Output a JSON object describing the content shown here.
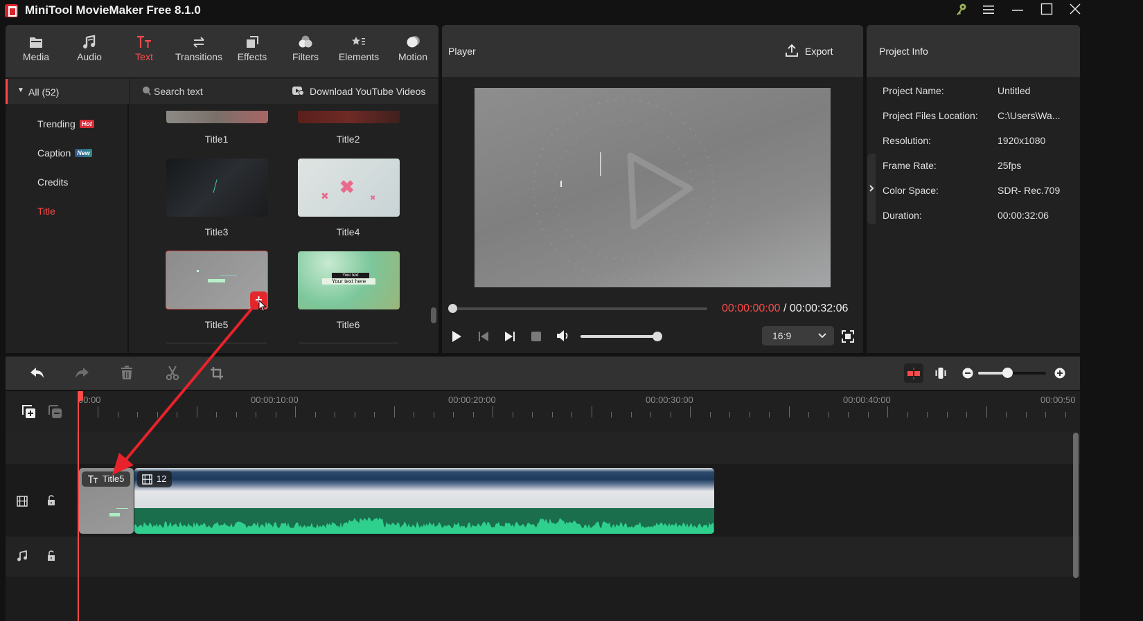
{
  "window": {
    "title": "MiniTool MovieMaker Free 8.1.0",
    "controls": [
      "key-icon",
      "menu-icon",
      "minimize-icon",
      "maximize-icon",
      "close-icon"
    ]
  },
  "top_tabs": [
    {
      "label": "Media",
      "icon": "folder-icon"
    },
    {
      "label": "Audio",
      "icon": "music-note-icon"
    },
    {
      "label": "Text",
      "icon": "text-icon",
      "active": true
    },
    {
      "label": "Transitions",
      "icon": "swap-arrows-icon"
    },
    {
      "label": "Effects",
      "icon": "layers-icon"
    },
    {
      "label": "Filters",
      "icon": "filters-icon"
    },
    {
      "label": "Elements",
      "icon": "star-list-icon"
    },
    {
      "label": "Motion",
      "icon": "motion-ball-icon"
    }
  ],
  "library": {
    "all_label": "All (52)",
    "categories": [
      {
        "label": "Trending",
        "badge": "Hot"
      },
      {
        "label": "Caption",
        "badge": "New"
      },
      {
        "label": "Credits",
        "badge": ""
      },
      {
        "label": "Title",
        "badge": "",
        "active": true
      }
    ],
    "search_placeholder": "Search text",
    "download_label": "Download YouTube Videos",
    "items": [
      {
        "label": "Title1"
      },
      {
        "label": "Title2"
      },
      {
        "label": "Title3"
      },
      {
        "label": "Title4"
      },
      {
        "label": "Title5",
        "selected": true
      },
      {
        "label": "Title6",
        "preview_small": "Your text",
        "preview_main": "Your text here"
      }
    ]
  },
  "player": {
    "title": "Player",
    "export_label": "Export",
    "current_time": "00:00:00:00",
    "separator": "/",
    "total_time": "00:00:32:06",
    "progress": 0,
    "volume": 1.0,
    "aspect_ratio": "16:9"
  },
  "project_info": {
    "title": "Project Info",
    "rows": [
      {
        "key": "Project Name:",
        "value": "Untitled"
      },
      {
        "key": "Project Files Location:",
        "value": "C:\\Users\\Wa..."
      },
      {
        "key": "Resolution:",
        "value": "1920x1080"
      },
      {
        "key": "Frame Rate:",
        "value": "25fps"
      },
      {
        "key": "Color Space:",
        "value": "SDR- Rec.709"
      },
      {
        "key": "Duration:",
        "value": "00:00:32:06"
      }
    ]
  },
  "timeline": {
    "zoom_level": 0.5,
    "ruler_labels": [
      "00:00",
      "00:00:10:00",
      "00:00:20:00",
      "00:00:30:00",
      "00:00:40:00",
      "00:00:50"
    ],
    "title_clip": {
      "label": "Title5"
    },
    "video_clip": {
      "count": "12"
    }
  },
  "colors": {
    "accent": "#ff4a4a",
    "hot_badge": "#d62b36",
    "new_badge": "#3b5a8c",
    "audio_wave": "#2fd08e",
    "audio_bg": "#1a6e4c"
  }
}
